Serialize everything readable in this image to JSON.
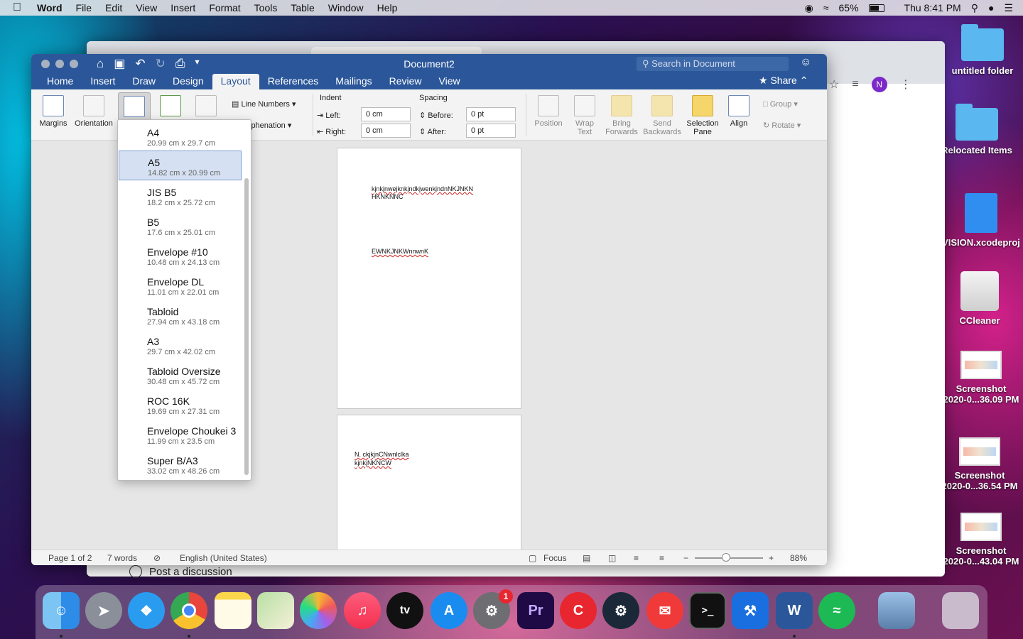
{
  "menubar": {
    "app": "Word",
    "items": [
      "File",
      "Edit",
      "View",
      "Insert",
      "Format",
      "Tools",
      "Table",
      "Window",
      "Help"
    ],
    "battery": "65%",
    "clock": "Thu 8:41 PM"
  },
  "word": {
    "doc_title": "Document2",
    "search_placeholder": "Search in Document",
    "tabs": [
      "Home",
      "Insert",
      "Draw",
      "Design",
      "Layout",
      "References",
      "Mailings",
      "Review",
      "View"
    ],
    "active_tab": "Layout",
    "share": "Share",
    "ribbon": {
      "margins": "Margins",
      "orientation": "Orientation",
      "line_numbers": "Line Numbers",
      "hyphenation": "Hyphenation",
      "indent": "Indent",
      "spacing": "Spacing",
      "left": "Left:",
      "right": "Right:",
      "before": "Before:",
      "after": "After:",
      "left_val": "0 cm",
      "right_val": "0 cm",
      "before_val": "0 pt",
      "after_val": "0 pt",
      "position": "Position",
      "wrap_text_1": "Wrap",
      "wrap_text_2": "Text",
      "bring_1": "Bring",
      "bring_2": "Forwards",
      "send_1": "Send",
      "send_2": "Backwards",
      "selection_1": "Selection",
      "selection_2": "Pane",
      "align": "Align",
      "group": "Group",
      "rotate": "Rotate"
    },
    "page_sizes": [
      {
        "name": "A4",
        "dim": "20.99 cm x 29.7 cm"
      },
      {
        "name": "A5",
        "dim": "14.82 cm x 20.99 cm"
      },
      {
        "name": "JIS B5",
        "dim": "18.2 cm x 25.72 cm"
      },
      {
        "name": "B5",
        "dim": "17.6 cm x 25.01 cm"
      },
      {
        "name": "Envelope #10",
        "dim": "10.48 cm x 24.13 cm"
      },
      {
        "name": "Envelope DL",
        "dim": "11.01 cm x 22.01 cm"
      },
      {
        "name": "Tabloid",
        "dim": "27.94 cm x 43.18 cm"
      },
      {
        "name": "A3",
        "dim": "29.7 cm x 42.02 cm"
      },
      {
        "name": "Tabloid Oversize",
        "dim": "30.48 cm x 45.72 cm"
      },
      {
        "name": "ROC 16K",
        "dim": "19.69 cm x 27.31 cm"
      },
      {
        "name": "Envelope Choukei 3",
        "dim": "11.99 cm x 23.5 cm"
      },
      {
        "name": "Super B/A3",
        "dim": "33.02 cm x 48.26 cm"
      }
    ],
    "selected_size": "A5",
    "page1": {
      "line1": "kjnkjnwejknkjndkjwenkjndnNKJNKN",
      "line2": "HKNKNNC",
      "line3": "EWNKJNKWnnwnK"
    },
    "page2": {
      "line1": "N. ckjkjnCNwnlclka",
      "line2": "kjnkjNKNCW"
    },
    "status": {
      "page": "Page 1 of 2",
      "words": "7 words",
      "language": "English (United States)",
      "focus": "Focus",
      "zoom": "88%"
    }
  },
  "chrome": {
    "post": "Post a discussion",
    "avatar": "N"
  },
  "desktop": {
    "items": [
      "untitled folder",
      "Relocated Items",
      "VISION.xcodeproj",
      "CCleaner",
      "Screenshot",
      "2020-0...36.09 PM",
      "Screenshot",
      "2020-0...36.54 PM",
      "Screenshot",
      "2020-0...43.04 PM"
    ]
  },
  "dock": {
    "apps": [
      "Finder",
      "Launchpad",
      "Safari",
      "Chrome",
      "Notes",
      "Maps",
      "Photos",
      "Music",
      "TV",
      "App Store",
      "System Preferences",
      "Premiere Pro",
      "CCleaner",
      "Steam",
      "Mail",
      "Terminal",
      "Xcode",
      "Word",
      "Spotify",
      "Preview",
      "Trash"
    ],
    "pr_label": "Pr",
    "tv_label": "tv",
    "word_label": "W",
    "terminal_label": ">_",
    "sys_badge": "1"
  }
}
